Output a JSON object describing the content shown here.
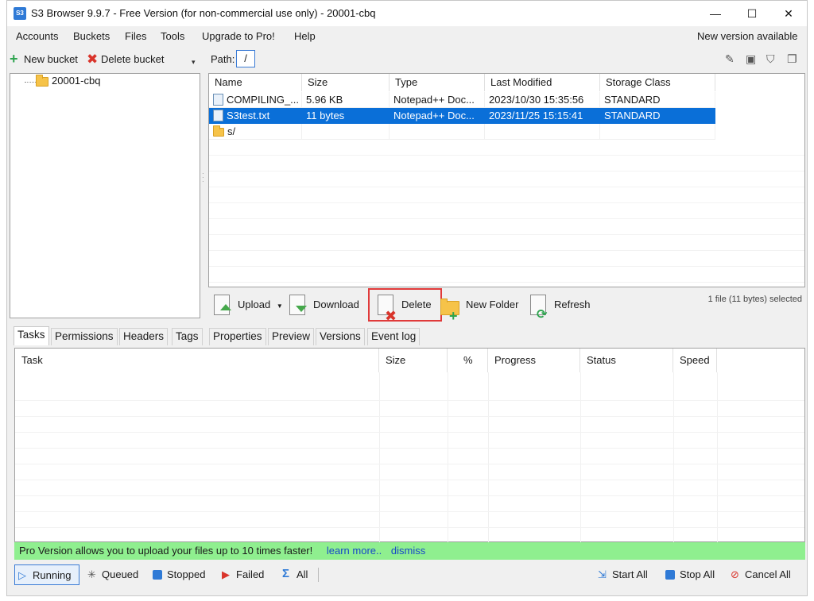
{
  "window": {
    "title": "S3 Browser 9.9.7 - Free Version (for non-commercial use only) - 20001-cbq",
    "app_icon_text": "S3"
  },
  "controls": {
    "minimize": "—",
    "maximize": "☐",
    "close": "✕"
  },
  "menu": {
    "items": [
      "Accounts",
      "Buckets",
      "Files",
      "Tools",
      "Upgrade to Pro!",
      "Help"
    ],
    "new_version": "New version available"
  },
  "left": {
    "new_bucket": "New bucket",
    "delete_bucket": "Delete bucket",
    "tree": [
      {
        "label": "20001-cbq"
      }
    ]
  },
  "path": {
    "label": "Path:",
    "value": "/"
  },
  "files": {
    "columns": [
      "Name",
      "Size",
      "Type",
      "Last Modified",
      "Storage Class"
    ],
    "rows": [
      {
        "name": "COMPILING_...",
        "size": "5.96 KB",
        "type": "Notepad++ Doc...",
        "modified": "2023/10/30 15:35:56",
        "storage": "STANDARD",
        "kind": "file",
        "selected": false
      },
      {
        "name": "S3test.txt",
        "size": "11 bytes",
        "type": "Notepad++ Doc...",
        "modified": "2023/11/25 15:15:41",
        "storage": "STANDARD",
        "kind": "file",
        "selected": true
      },
      {
        "name": "s/",
        "size": "",
        "type": "",
        "modified": "",
        "storage": "",
        "kind": "folder",
        "selected": false
      }
    ]
  },
  "actions": {
    "upload": "Upload",
    "download": "Download",
    "delete": "Delete",
    "new_folder": "New Folder",
    "refresh": "Refresh",
    "selection_status": "1 file (11 bytes) selected"
  },
  "tabs": [
    "Tasks",
    "Permissions",
    "Headers",
    "Tags",
    "Properties",
    "Preview",
    "Versions",
    "Event log"
  ],
  "tasks": {
    "columns": [
      "Task",
      "Size",
      "%",
      "Progress",
      "Status",
      "Speed"
    ]
  },
  "promo": {
    "text": "Pro Version allows you to upload your files up to 10 times faster!",
    "learn_more": "learn more..",
    "dismiss": "dismiss"
  },
  "bottom": {
    "running": "Running",
    "queued": "Queued",
    "stopped": "Stopped",
    "failed": "Failed",
    "all": "All",
    "start_all": "Start All",
    "stop_all": "Stop All",
    "cancel_all": "Cancel All"
  },
  "colors": {
    "selection": "#0a6fd8",
    "promo_bg": "#8fef8f",
    "highlight": "#e03a3a"
  }
}
